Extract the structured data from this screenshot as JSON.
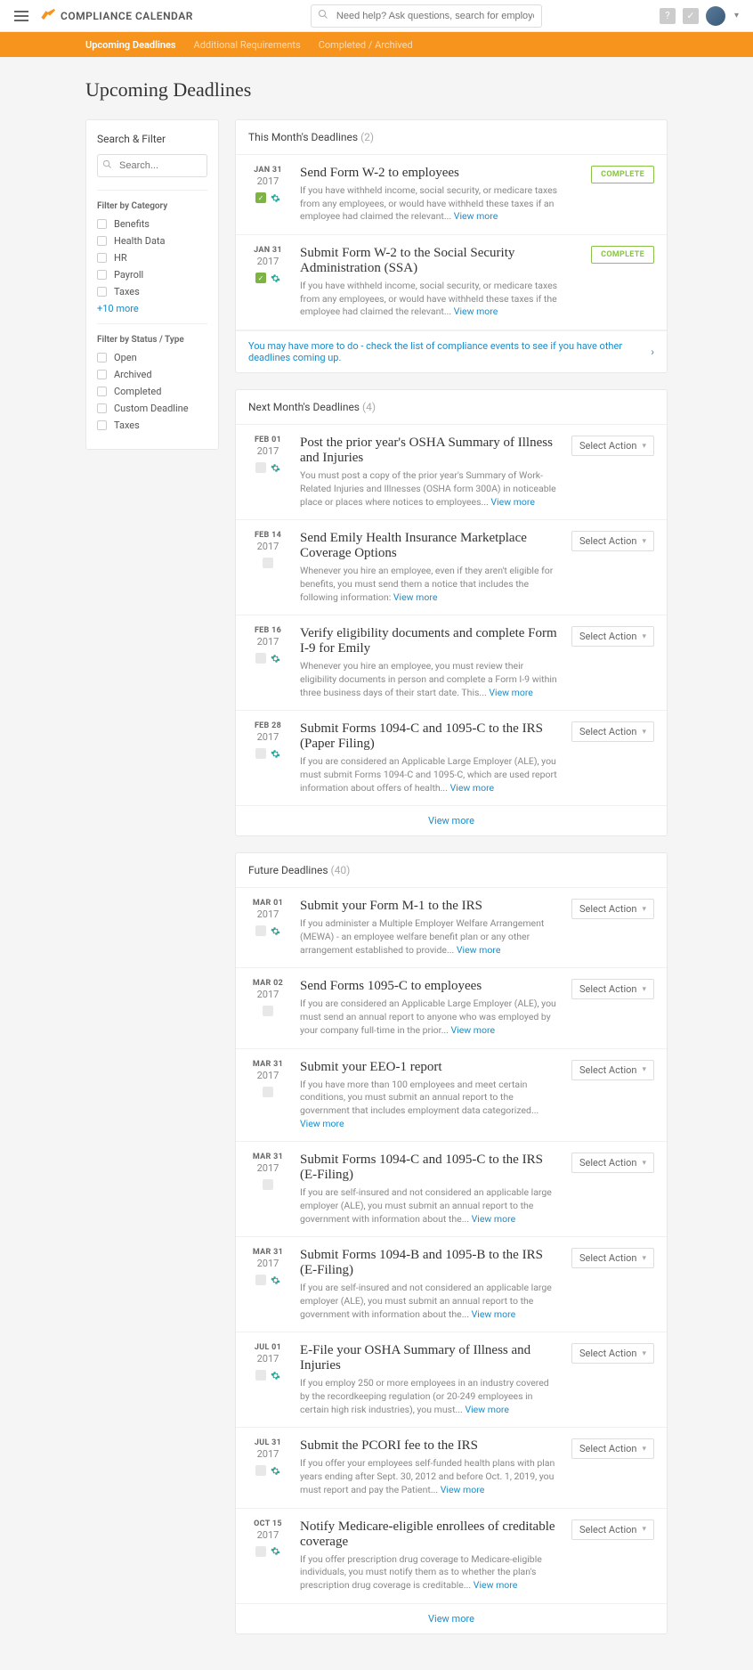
{
  "header": {
    "appName": "COMPLIANCE CALENDAR",
    "searchPlaceholder": "Need help? Ask questions, search for employees, and more..."
  },
  "tabs": [
    {
      "label": "Upcoming Deadlines",
      "active": true
    },
    {
      "label": "Additional Requirements",
      "active": false
    },
    {
      "label": "Completed / Archived",
      "active": false
    }
  ],
  "pageTitle": "Upcoming Deadlines",
  "sidebar": {
    "title": "Search & Filter",
    "searchPlaceholder": "Search...",
    "categoryLabel": "Filter by Category",
    "categories": [
      "Benefits",
      "Health Data",
      "HR",
      "Payroll",
      "Taxes"
    ],
    "moreText": "+10 more",
    "statusLabel": "Filter by Status / Type",
    "statuses": [
      "Open",
      "Archived",
      "Completed",
      "Custom Deadline",
      "Taxes"
    ]
  },
  "panels": {
    "thisMonth": {
      "title": "This Month's Deadlines",
      "count": "(2)",
      "items": [
        {
          "dateMd": "JAN 31",
          "dateYr": "2017",
          "title": "Send Form W-2 to employees",
          "desc": "If you have withheld income, social security, or medicare taxes from any employees, or would have withheld these taxes if an employee had claimed the relevant...",
          "complete": true,
          "check": true,
          "gear": true
        },
        {
          "dateMd": "JAN 31",
          "dateYr": "2017",
          "title": "Submit Form W-2 to the Social Security Administration (SSA)",
          "desc": "If you have withheld income, social security, or medicare taxes from any employees, or would have withheld these taxes if the employee had claimed the relevant...",
          "complete": true,
          "check": true,
          "gear": true
        }
      ],
      "infoRow": "You may have more to do - check the list of compliance events to see if you have other deadlines coming up."
    },
    "nextMonth": {
      "title": "Next Month's Deadlines",
      "count": "(4)",
      "items": [
        {
          "dateMd": "FEB 01",
          "dateYr": "2017",
          "title": "Post the prior year's OSHA Summary of Illness and Injuries",
          "desc": "You must post a copy of the prior year's Summary of Work-Related Injuries and Illnesses (OSHA form 300A) in noticeable place or places where notices to employees...",
          "gear": true
        },
        {
          "dateMd": "FEB 14",
          "dateYr": "2017",
          "title": "Send Emily Health Insurance Marketplace Coverage Options",
          "desc": "Whenever you hire an employee, even if they aren't eligible for benefits, you must send them a notice that includes the following information:"
        },
        {
          "dateMd": "FEB 16",
          "dateYr": "2017",
          "title": "Verify eligibility documents and complete Form I-9 for Emily",
          "desc": "Whenever you hire an employee, you must review their eligibility documents in person and complete a Form I-9 within three business days of their start date. This...",
          "gear": true
        },
        {
          "dateMd": "FEB 28",
          "dateYr": "2017",
          "title": "Submit Forms 1094-C and 1095-C to the IRS (Paper Filing)",
          "desc": "If you are considered an Applicable Large Employer (ALE), you must submit Forms 1094-C and 1095-C, which are used report information about offers of health...",
          "gear": true
        }
      ]
    },
    "future": {
      "title": "Future Deadlines",
      "count": "(40)",
      "items": [
        {
          "dateMd": "MAR 01",
          "dateYr": "2017",
          "title": "Submit your Form M-1 to the IRS",
          "desc": "If you administer a Multiple Employer Welfare Arrangement (MEWA) - an employee welfare benefit plan or any other arrangement established to provide...",
          "gear": true
        },
        {
          "dateMd": "MAR 02",
          "dateYr": "2017",
          "title": "Send Forms 1095-C to employees",
          "desc": "If you are considered an Applicable Large Employer (ALE), you must send an annual report to anyone who was employed by your company full-time in the prior..."
        },
        {
          "dateMd": "MAR 31",
          "dateYr": "2017",
          "title": "Submit your EEO-1 report",
          "desc": "If you have more than 100 employees and meet certain conditions, you must submit an annual report to the government that includes employment data categorized..."
        },
        {
          "dateMd": "MAR 31",
          "dateYr": "2017",
          "title": "Submit Forms 1094-C and 1095-C to the IRS (E-Filing)",
          "desc": "If you are self-insured and not considered an applicable large employer (ALE), you must submit an annual report to the government with information about the..."
        },
        {
          "dateMd": "MAR 31",
          "dateYr": "2017",
          "title": "Submit Forms 1094-B and 1095-B to the IRS (E-Filing)",
          "desc": "If you are self-insured and not considered an applicable large employer (ALE), you must submit an annual report to the government with information about the...",
          "gear": true
        },
        {
          "dateMd": "JUL 01",
          "dateYr": "2017",
          "title": "E-File your OSHA Summary of Illness and Injuries",
          "desc": "If you employ 250 or more employees in an industry covered by the recordkeeping regulation (or 20-249 employees in certain high risk industries), you must...",
          "gear": true
        },
        {
          "dateMd": "JUL 31",
          "dateYr": "2017",
          "title": "Submit the PCORI fee to the IRS",
          "desc": "If you offer your employees self-funded health plans with plan years ending after Sept. 30, 2012 and before Oct. 1, 2019, you must report and pay the Patient...",
          "gear": true
        },
        {
          "dateMd": "OCT 15",
          "dateYr": "2017",
          "title": "Notify Medicare-eligible enrollees of creditable coverage",
          "desc": "If you offer prescription drug coverage to Medicare-eligible individuals, you must notify them as to whether the plan's prescription drug coverage is creditable...",
          "gear": true
        }
      ]
    }
  },
  "labels": {
    "viewMore": "View more",
    "selectAction": "Select Action",
    "complete": "COMPLETE"
  }
}
